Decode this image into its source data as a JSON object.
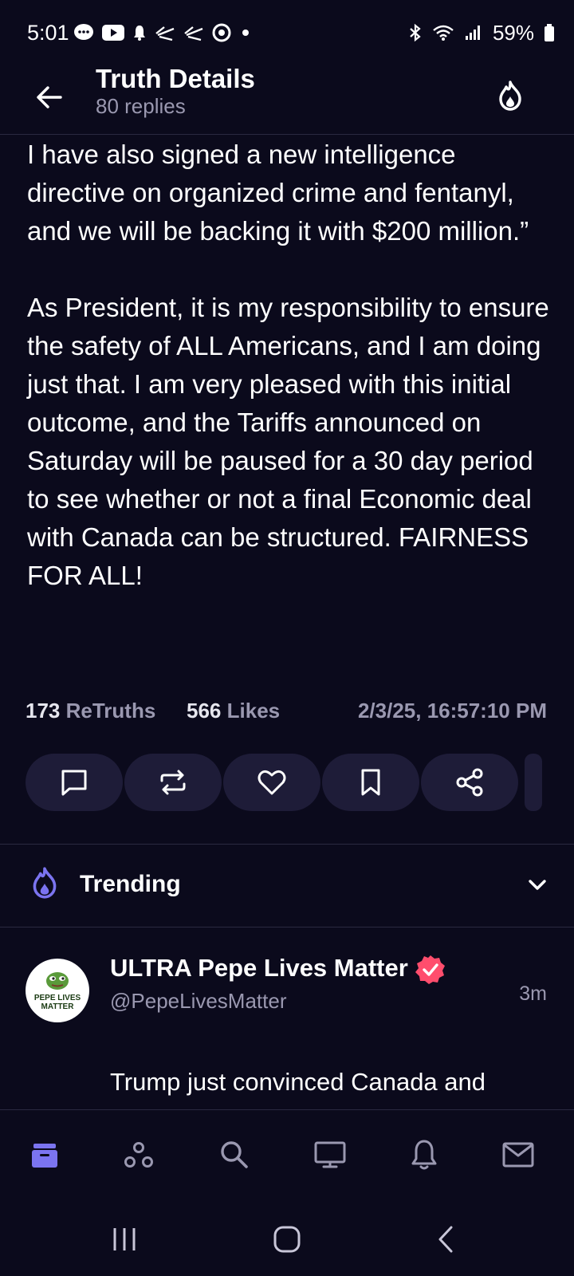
{
  "status_bar": {
    "time": "5:01",
    "battery": "59%",
    "left_icons": [
      "chat-icon",
      "youtube-icon",
      "notification-icon",
      "app-icon",
      "app-icon",
      "threads-icon",
      "dot-icon"
    ],
    "right_icons": [
      "bluetooth-icon",
      "wifi-icon",
      "signal-icon",
      "battery-icon"
    ]
  },
  "header": {
    "title": "Truth Details",
    "subtitle": "80 replies"
  },
  "post": {
    "text": "I have also signed a new intelligence directive on organized crime and fentanyl, and we will be backing it with $200 million.”\n\nAs President, it is my responsibility to ensure the safety of ALL Americans, and I am doing just that. I am very pleased with this initial outcome, and the Tariffs announced on Saturday will be paused for a 30 day period to see whether or not a final Economic deal with Canada can be structured. FAIRNESS FOR ALL!",
    "retruths_count": "173",
    "retruths_label": "ReTruths",
    "likes_count": "566",
    "likes_label": "Likes",
    "timestamp": "2/3/25, 16:57:10 PM"
  },
  "actions": [
    "reply-icon",
    "retruth-icon",
    "like-icon",
    "bookmark-icon",
    "share-icon"
  ],
  "trending": {
    "label": "Trending"
  },
  "reply": {
    "avatar_text": "PEPE LIVES MATTER",
    "name": "ULTRA Pepe Lives Matter",
    "handle": "@PepeLivesMatter",
    "time": "3m",
    "text": "Trump just convinced Canada and Mexico to implement his border"
  },
  "colors": {
    "background": "#0b0a1c",
    "accent": "#7b74f0",
    "verified": "#ff4d6d",
    "muted": "#9a98b0",
    "button": "#1e1c38"
  }
}
